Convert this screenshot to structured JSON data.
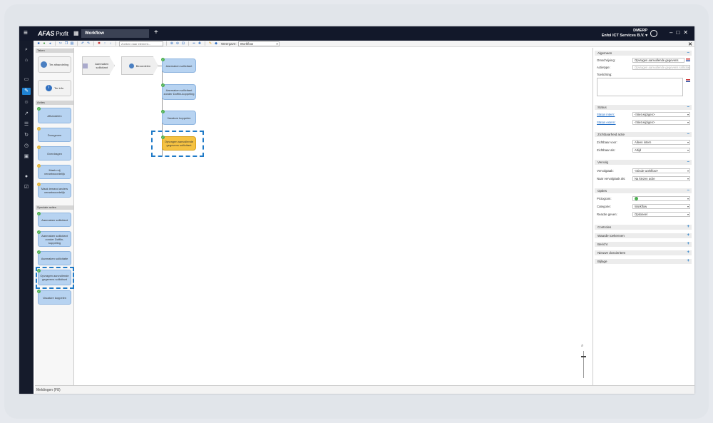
{
  "topbar": {
    "brand": "AFAS",
    "product": "Profit",
    "active_tab": "Workflow",
    "user_name": "DMERP",
    "user_org": "Enfol ICT Services B.V. ▾"
  },
  "toolbar": {
    "search_placeholder": "Zoeken naar element...",
    "view_label": "Weergave:",
    "view_value": "Workflow"
  },
  "palette": {
    "sections": {
      "taken": "Taken",
      "acties": "Acties",
      "speciale": "Speciale acties"
    },
    "taken_items": [
      "Ter afhandeling",
      "Ter info"
    ],
    "acties_items": [
      "Afhandelen",
      "Doorgeven",
      "Overdragen",
      "Maak mij verantwoordelijk",
      "Maak iemand anders verantwoordelijk"
    ],
    "speciale_items": [
      "Aanmaken sollicitant",
      "Aanmaken sollicitant zonder Dofflin-koppeling",
      "Aanmaken sollicitatie",
      "Opvragen aanvullende gegevens sollicitant",
      "Vacature koppelen"
    ]
  },
  "canvas": {
    "start_node": "Aanmaken sollicitant",
    "task_node": "Beoordelen",
    "actions": [
      "Aanmaken sollicitant",
      "Aanmaken sollicitant zonder Dofflin-koppeling",
      "Vacature koppelen",
      "Opvragen aanvullende gegevens sollicitant"
    ]
  },
  "props": {
    "algemeen": {
      "title": "Algemeen",
      "omschrijving_label": "Omschrijving:",
      "omschrijving_value": "Opvragen aanvullende gegevens",
      "actietype_label": "Actietype:",
      "actietype_value": "Opvragen aanvullende gegevens sollicitant",
      "toelichting_label": "Toelichting:"
    },
    "status": {
      "title": "Status",
      "intern_label": "Status intern:",
      "intern_value": "<Niet wijzigen>",
      "extern_label": "Status extern:",
      "extern_value": "<Niet wijzigen>"
    },
    "zichtbaarheid": {
      "title": "Zichtbaarheid actie",
      "voor_label": "Zichtbaar voor:",
      "voor_value": "Alleen intern",
      "als_label": "Zichtbaar als:",
      "als_value": "Altijd"
    },
    "vervolg": {
      "title": "Vervolg",
      "vervolgtaak_label": "Vervolgtaak:",
      "vervolgtaak_value": "<Einde workflow>",
      "naar_label": "Naar vervolgtaak als:",
      "naar_value": "Na kiezen actie"
    },
    "opties": {
      "title": "Opties",
      "pictogram_label": "Pictogram:",
      "categorie_label": "Categorie:",
      "categorie_value": "Workflow",
      "reactie_label": "Reactie geven:",
      "reactie_value": "Optioneel"
    },
    "collapsed": [
      "Controles",
      "Waarde toekennen",
      "Bericht",
      "Nieuwe dossieritem",
      "Bijlage"
    ]
  },
  "statusbar": {
    "label": "Meldingen (F8)"
  }
}
